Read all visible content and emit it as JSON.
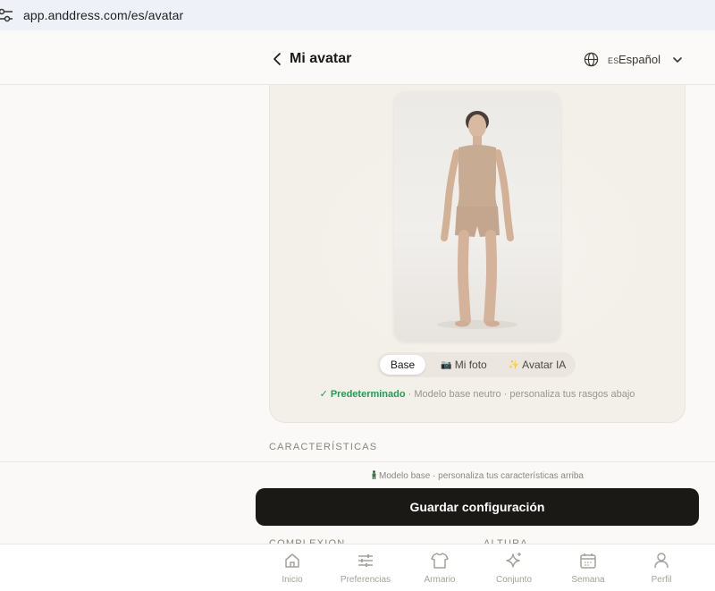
{
  "browser": {
    "url": "app.anddress.com/es/avatar"
  },
  "header": {
    "title": "Mi avatar",
    "language_code": "ES",
    "language_name": "Español"
  },
  "avatar": {
    "modes": [
      {
        "label": "Base",
        "icon": "",
        "selected": true
      },
      {
        "label": "Mi foto",
        "icon": "camera-icon",
        "selected": false
      },
      {
        "label": "Avatar IA",
        "icon": "sparkle-icon",
        "selected": false
      }
    ],
    "status_badge": "✓ Predeterminado",
    "status_text": " · Modelo base neutro · personaliza tus rasgos abajo"
  },
  "characteristics": {
    "section_label": "CARACTERÍSTICAS",
    "hint": "Modelo base · personaliza tus características arriba",
    "save_label": "Guardar configuración",
    "peek_left": "COMPLEXION",
    "peek_right": "ALTURA"
  },
  "bottom_nav": {
    "items": [
      {
        "label": "Inicio",
        "icon": "home-icon"
      },
      {
        "label": "Preferencias",
        "icon": "sliders-icon"
      },
      {
        "label": "Armario",
        "icon": "shirt-icon"
      },
      {
        "label": "Conjunto",
        "icon": "sparkles-icon"
      },
      {
        "label": "Semana",
        "icon": "calendar-icon"
      },
      {
        "label": "Perfil",
        "icon": "user-icon"
      }
    ]
  },
  "colors": {
    "accent_green": "#1f9d55",
    "button_dark": "#1b1916",
    "card_bg": "#f3efe9"
  }
}
